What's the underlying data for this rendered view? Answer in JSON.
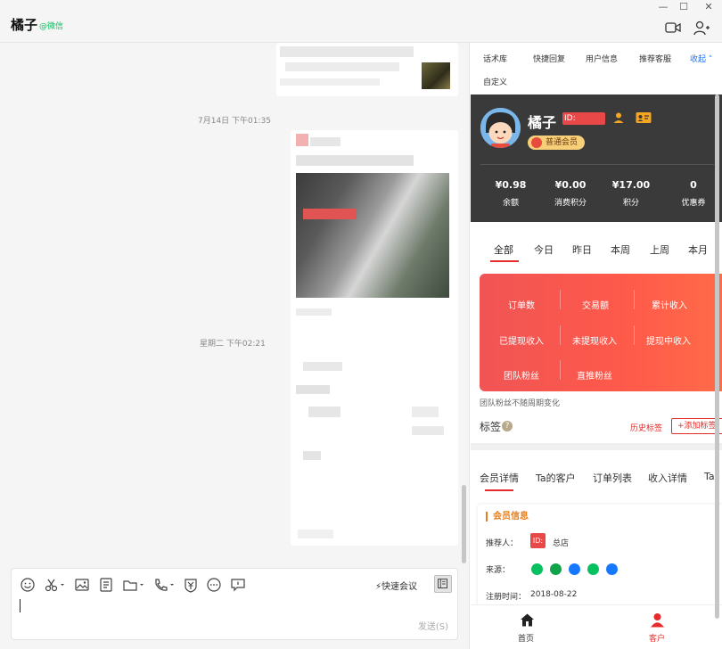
{
  "header": {
    "contact_name": "橘子",
    "contact_source": "@微信"
  },
  "chat": {
    "timestamps": [
      "7月14日 下午01:35",
      "星期二 下午02:21"
    ]
  },
  "input": {
    "quick_meeting": "快速会议",
    "send": "发送(S)"
  },
  "right_panel": {
    "tabs": [
      "话术库",
      "快捷回复",
      "用户信息",
      "推荐客服",
      "收起",
      "自定义"
    ],
    "profile": {
      "name": "橘子",
      "id_label": "ID:",
      "member_level": "普通会员",
      "stats": [
        {
          "value": "¥0.98",
          "label": "余额"
        },
        {
          "value": "¥0.00",
          "label": "消费积分"
        },
        {
          "value": "¥17.00",
          "label": "积分"
        },
        {
          "value": "0",
          "label": "优惠券"
        }
      ]
    },
    "period_tabs": [
      "全部",
      "今日",
      "昨日",
      "本周",
      "上周",
      "本月"
    ],
    "kpis": [
      "订单数",
      "交易额",
      "累计收入",
      "已提现收入",
      "未提现收入",
      "提现中收入",
      "团队粉丝",
      "直推粉丝"
    ],
    "note": "团队粉丝不随周期变化",
    "tags": {
      "title": "标签",
      "history": "历史标签",
      "add": "+添加标签"
    },
    "member_tabs": [
      "会员详情",
      "Ta的客户",
      "订单列表",
      "收入详情",
      "Ta"
    ],
    "member_info": {
      "title": "会员信息",
      "referrer_label": "推荐人：",
      "referrer_badge": "ID:",
      "referrer_value": "总店",
      "source_label": "来源：",
      "reg_label": "注册时间：",
      "reg_value": "2018-08-22"
    },
    "bottom_nav": {
      "home": "首页",
      "customer": "客户"
    },
    "colors": {
      "accent": "#e52c2c",
      "panel_dark": "#3a3a3a",
      "source_green": "#07c160"
    }
  }
}
